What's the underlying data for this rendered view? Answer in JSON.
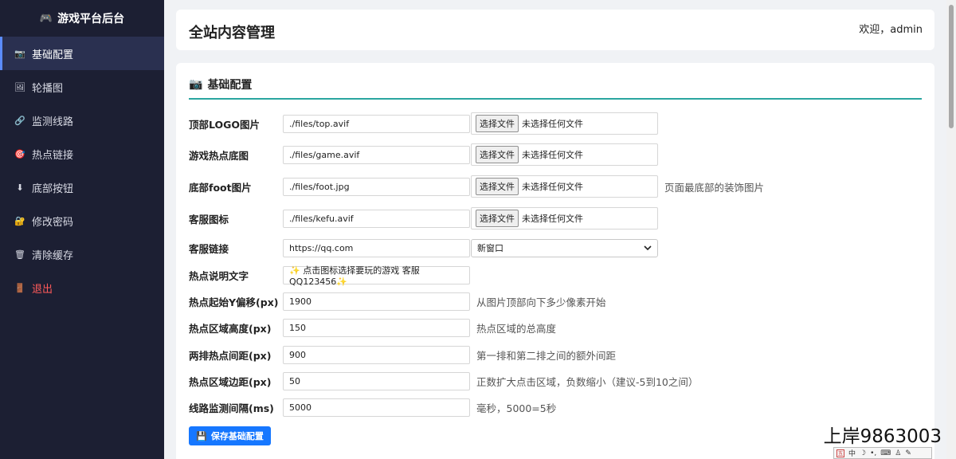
{
  "sidebar": {
    "brand": "游戏平台后台",
    "brand_icon": "🎮",
    "items": [
      {
        "label": "基础配置",
        "icon": "📷",
        "active": true
      },
      {
        "label": "轮播图",
        "icon": "🖼"
      },
      {
        "label": "监测线路",
        "icon": "🔗"
      },
      {
        "label": "热点链接",
        "icon": "🎯"
      },
      {
        "label": "底部按钮",
        "icon": "⬇"
      },
      {
        "label": "修改密码",
        "icon": "🔐"
      },
      {
        "label": "清除缓存",
        "icon": "🗑"
      },
      {
        "label": "退出",
        "icon": "🚪",
        "logout": true
      }
    ]
  },
  "header": {
    "title": "全站内容管理",
    "welcome": "欢迎，admin"
  },
  "main": {
    "section_title": "基础配置",
    "section_icon": "📷",
    "file_button": "选择文件",
    "file_none": "未选择任何文件",
    "fields": {
      "top_logo": {
        "label": "顶部LOGO图片",
        "value": "./files/top.avif"
      },
      "game_bg": {
        "label": "游戏热点底图",
        "value": "./files/game.avif"
      },
      "foot_img": {
        "label": "底部foot图片",
        "value": "./files/foot.jpg",
        "hint": "页面最底部的装饰图片"
      },
      "kefu_icon": {
        "label": "客服图标",
        "value": "./files/kefu.avif"
      },
      "kefu_link": {
        "label": "客服链接",
        "value": "https://qq.com",
        "select": "新窗口"
      },
      "hot_text": {
        "label": "热点说明文字",
        "value": "✨ 点击图标选择要玩的游戏 客服QQ123456✨"
      },
      "hot_y": {
        "label": "热点起始Y偏移(px)",
        "value": "1900",
        "hint": "从图片顶部向下多少像素开始"
      },
      "hot_h": {
        "label": "热点区域高度(px)",
        "value": "150",
        "hint": "热点区域的总高度"
      },
      "row_gap": {
        "label": "两排热点间距(px)",
        "value": "900",
        "hint": "第一排和第二排之间的额外间距"
      },
      "hot_margin": {
        "label": "热点区域边距(px)",
        "value": "50",
        "hint": "正数扩大点击区域，负数缩小（建议-5到10之间）"
      },
      "interval": {
        "label": "线路监测间隔(ms)",
        "value": "5000",
        "hint": "毫秒，5000=5秒"
      }
    },
    "save_button": "保存基础配置",
    "save_icon": "💾"
  },
  "watermark": "上岸9863003",
  "ime": {
    "lang": "中"
  },
  "colors": {
    "sidebar_bg": "#1c1f33",
    "accent": "#1677ff",
    "section_line": "#2aa6a0",
    "logout": "#ff5a5a"
  }
}
